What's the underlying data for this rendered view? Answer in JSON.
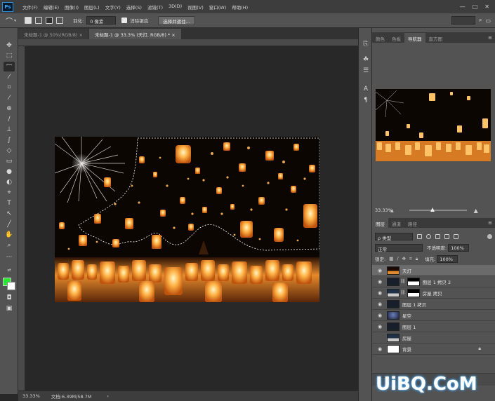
{
  "app": {
    "logo": "Ps"
  },
  "menu": [
    "文件(F)",
    "编辑(E)",
    "图像(I)",
    "图层(L)",
    "文字(Y)",
    "选择(S)",
    "滤镜(T)",
    "3D(D)",
    "视图(V)",
    "窗口(W)",
    "帮助(H)"
  ],
  "window_controls": {
    "minimize": "—",
    "maximize": "□",
    "close": "✕"
  },
  "options": {
    "feather_label": "羽化:",
    "feather_value": "0 像素",
    "antialias_label": "消除锯齿",
    "select_mask_button": "选择并遮住..."
  },
  "tabs": [
    {
      "label": "未标题-1 @ 50%(RGB/8) ×",
      "active": false
    },
    {
      "label": "未标题-1 @ 33.3% (天灯, RGB/8) * ×",
      "active": true
    }
  ],
  "status": {
    "zoom": "33.33%",
    "doc": "文档:6.39M/58.7M",
    "arrow": "›"
  },
  "panels": {
    "top_tabs": [
      "颜色",
      "色板",
      "导航器",
      "直方图"
    ],
    "active_top_tab": "导航器",
    "navigator_zoom": "33.33%",
    "layers_tabs": [
      "图层",
      "通道",
      "路径"
    ],
    "filter_kind": "ρ 类型",
    "blend_mode": "正常",
    "opacity_label": "不透明度:",
    "opacity_value": "100%",
    "lock_label": "锁定:",
    "fill_label": "填充:",
    "fill_value": "100%"
  },
  "layers": [
    {
      "name": "天灯",
      "visible": true,
      "selected": true,
      "mask": false,
      "thumb": "lanterns"
    },
    {
      "name": "图层 1 拷贝 2",
      "visible": true,
      "selected": false,
      "mask": true,
      "thumb": "dark"
    },
    {
      "name": "房屋 拷贝",
      "visible": true,
      "selected": false,
      "mask": true,
      "thumb": "town"
    },
    {
      "name": "图层 1 拷贝",
      "visible": true,
      "selected": false,
      "mask": false,
      "thumb": "dark"
    },
    {
      "name": "星空",
      "visible": true,
      "selected": false,
      "mask": false,
      "thumb": "sky"
    },
    {
      "name": "图层 1",
      "visible": true,
      "selected": false,
      "mask": false,
      "thumb": "dark"
    },
    {
      "name": "房屋",
      "visible": false,
      "selected": false,
      "mask": false,
      "thumb": "town"
    },
    {
      "name": "背景",
      "visible": true,
      "selected": false,
      "mask": false,
      "thumb": "white",
      "locked": true
    }
  ],
  "watermark": "UiBQ.CoM",
  "colors": {
    "foreground": "#25e82a",
    "background": "#ffffff",
    "accent": "#31a8ff"
  }
}
